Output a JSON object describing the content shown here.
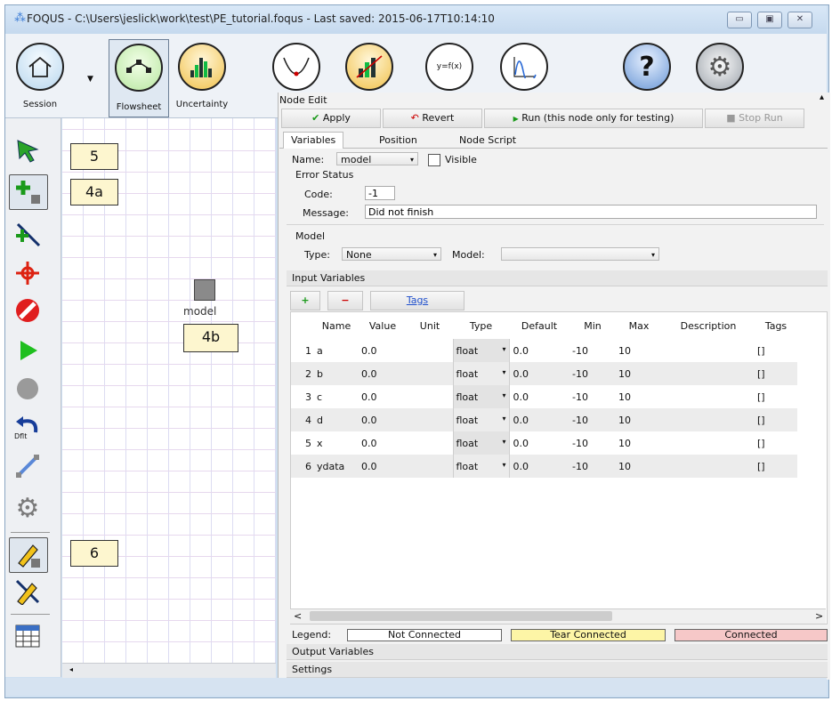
{
  "window": {
    "title": "FOQUS - C:\\Users\\jeslick\\work\\test\\PE_tutorial.foqus - Last saved: 2015-06-17T10:14:10",
    "buttons": {
      "minimize": "▭",
      "maximize": "▣",
      "close": "✕"
    }
  },
  "toolbar": {
    "items": [
      {
        "label": "Session",
        "icon": "house-icon"
      },
      {
        "label": "Flowsheet",
        "icon": "flowsheet-icon",
        "selected": true
      },
      {
        "label": "Uncertainty",
        "icon": "histogram-icon"
      },
      {
        "label": "",
        "icon": "optimization-icon"
      },
      {
        "label": "",
        "icon": "regression-icon"
      },
      {
        "label": "",
        "icon": "surrogate-function-icon",
        "formula": "y=f(x)"
      },
      {
        "label": "",
        "icon": "curve-icon"
      },
      {
        "label": "",
        "icon": "help-icon"
      },
      {
        "label": "",
        "icon": "settings-gear-icon"
      }
    ]
  },
  "palette": {
    "annotations": {
      "a5": "5",
      "a4a": "4a",
      "a6": "6"
    },
    "default_label": "Dflt"
  },
  "canvas": {
    "node_label": "model",
    "annotation": "4b"
  },
  "node_edit": {
    "title": "Node Edit",
    "buttons": {
      "apply": "Apply",
      "revert": "Revert",
      "run": "Run (this node only for testing)",
      "stop": "Stop Run"
    },
    "tabs": [
      "Variables",
      "Position",
      "Node Script"
    ],
    "name_label": "Name:",
    "name_value": "model",
    "visible_label": "Visible",
    "error_status": {
      "heading": "Error Status",
      "code_label": "Code:",
      "code_value": "-1",
      "message_label": "Message:",
      "message_value": "Did not finish"
    },
    "model": {
      "heading": "Model",
      "type_label": "Type:",
      "type_value": "None",
      "model_label": "Model:",
      "model_value": ""
    },
    "input_variables": {
      "heading": "Input Variables",
      "add": "+",
      "remove": "−",
      "tags": "Tags",
      "columns": [
        "",
        "Name",
        "Value",
        "Unit",
        "Type",
        "Default",
        "Min",
        "Max",
        "Description",
        "Tags"
      ],
      "rows": [
        [
          "1",
          "a",
          "0.0",
          "",
          "float",
          "0.0",
          "-10",
          "10",
          "",
          "[]"
        ],
        [
          "2",
          "b",
          "0.0",
          "",
          "float",
          "0.0",
          "-10",
          "10",
          "",
          "[]"
        ],
        [
          "3",
          "c",
          "0.0",
          "",
          "float",
          "0.0",
          "-10",
          "10",
          "",
          "[]"
        ],
        [
          "4",
          "d",
          "0.0",
          "",
          "float",
          "0.0",
          "-10",
          "10",
          "",
          "[]"
        ],
        [
          "5",
          "x",
          "0.0",
          "",
          "float",
          "0.0",
          "-10",
          "10",
          "",
          "[]"
        ],
        [
          "6",
          "ydata",
          "0.0",
          "",
          "float",
          "0.0",
          "-10",
          "10",
          "",
          "[]"
        ]
      ]
    },
    "legend": {
      "label": "Legend:",
      "not_connected": "Not Connected",
      "tear_connected": "Tear Connected",
      "connected": "Connected",
      "colors": {
        "not_connected": "#ffffff",
        "tear_connected": "#fdf5a6",
        "connected": "#f6c8c8"
      }
    },
    "output_variables": "Output Variables",
    "settings": "Settings"
  }
}
